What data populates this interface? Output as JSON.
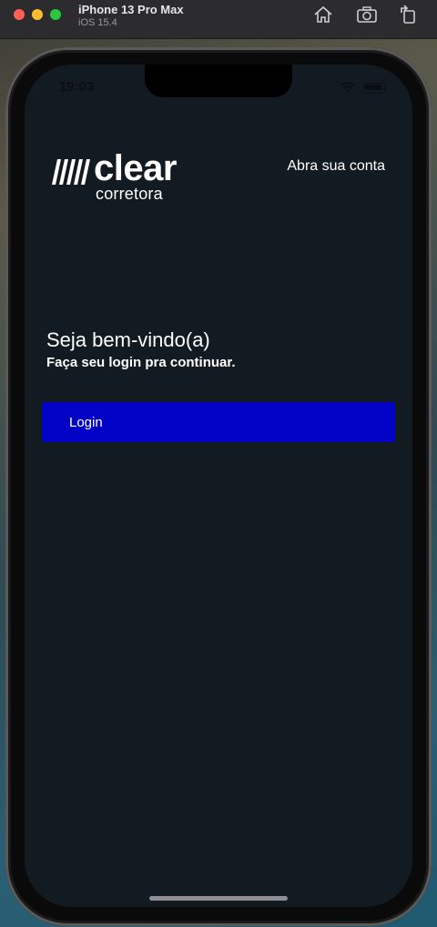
{
  "simulator": {
    "device_name": "iPhone 13 Pro Max",
    "os_version": "iOS 15.4",
    "buttons": [
      "home-icon",
      "screenshot-icon",
      "rotate-icon"
    ]
  },
  "status_bar": {
    "time": "19:03",
    "icons": [
      "wifi-icon",
      "battery-icon"
    ]
  },
  "header": {
    "logo_word": "clear",
    "logo_sub": "corretora",
    "open_account_label": "Abra sua conta"
  },
  "welcome": {
    "title": "Seja bem-vindo(a)",
    "subtitle": "Faça seu login pra continuar."
  },
  "actions": {
    "login_label": "Login"
  },
  "colors": {
    "background": "#131b22",
    "primary": "#0303c8",
    "text": "#ffffff"
  }
}
